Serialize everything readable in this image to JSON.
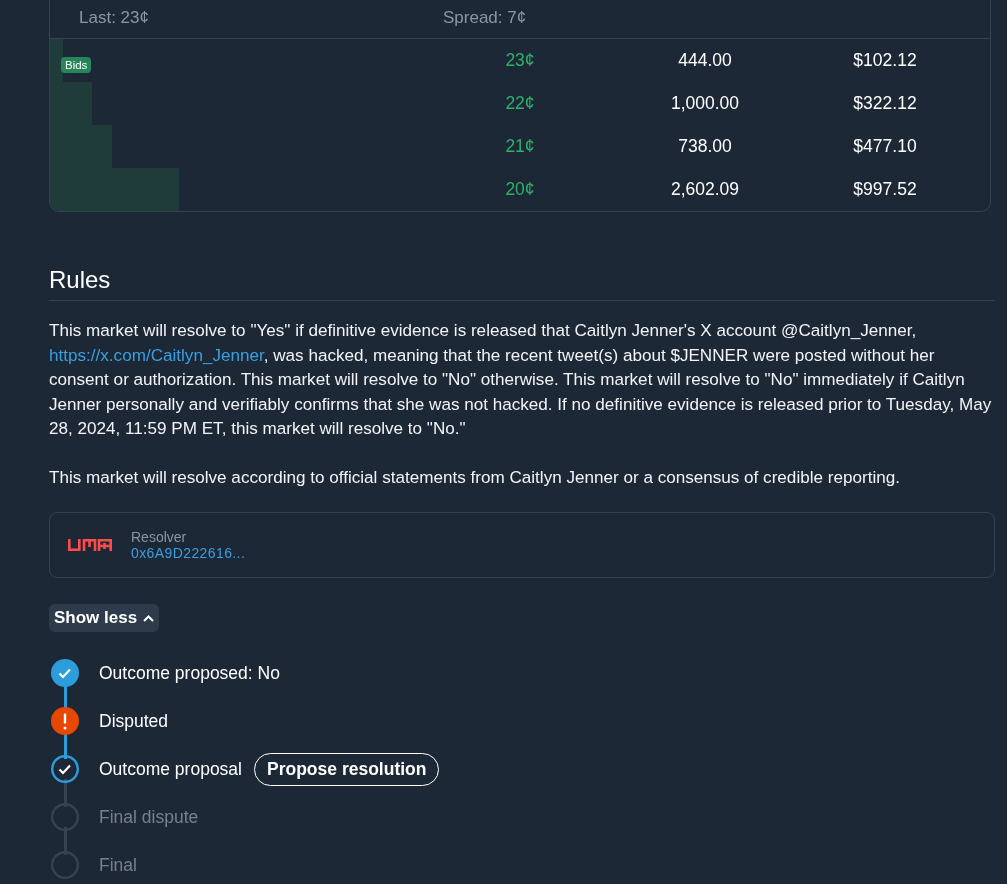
{
  "order_book": {
    "last": "Last: 23¢",
    "spread": "Spread: 7¢",
    "bids_label": "Bids",
    "bids": [
      {
        "price": "23¢",
        "shares": "444.00",
        "total": "$102.12",
        "level": 0.014
      },
      {
        "price": "22¢",
        "shares": "1,000.00",
        "total": "$322.12",
        "level": 0.045
      },
      {
        "price": "21¢",
        "shares": "738.00",
        "total": "$477.10",
        "level": 0.066
      },
      {
        "price": "20¢",
        "shares": "2,602.09",
        "total": "$997.52",
        "level": 0.137
      }
    ]
  },
  "rules": {
    "title": "Rules",
    "paragraphs": [
      {
        "text": "This market will resolve to \"Yes\" if definitive evidence is released that Caitlyn Jenner's X account @Caitlyn_Jenner, ",
        "link": "https://x.com/Caitlyn_Jenner",
        "text_after": ", was hacked, meaning that the recent tweet(s) about $JENNER were posted without her consent or authorization. This market will resolve to \"No\" otherwise. This market will resolve to \"No\" immediately if Caitlyn Jenner personally and verifiably confirms that she was not hacked. If no definitive evidence is released prior to Tuesday, May 28, 2024, 11:59 PM ET, this market will resolve to \"No.\""
      },
      {
        "text": "This market will resolve according to official statements from Caitlyn Jenner or a consensus of credible reporting."
      }
    ],
    "resolver": {
      "label": "Resolver",
      "address": "0x6A9D222616..."
    },
    "toggle": {
      "label": "Show less",
      "expanded": true
    }
  },
  "timeline": [
    {
      "label": "Outcome proposed: No",
      "kind": "done"
    },
    {
      "label": "Disputed",
      "kind": "disputed"
    },
    {
      "label": "Outcome proposal",
      "kind": "current",
      "action": "Propose resolution"
    },
    {
      "label": "Final dispute",
      "kind": "pending"
    },
    {
      "label": "Final",
      "kind": "pending"
    }
  ]
}
